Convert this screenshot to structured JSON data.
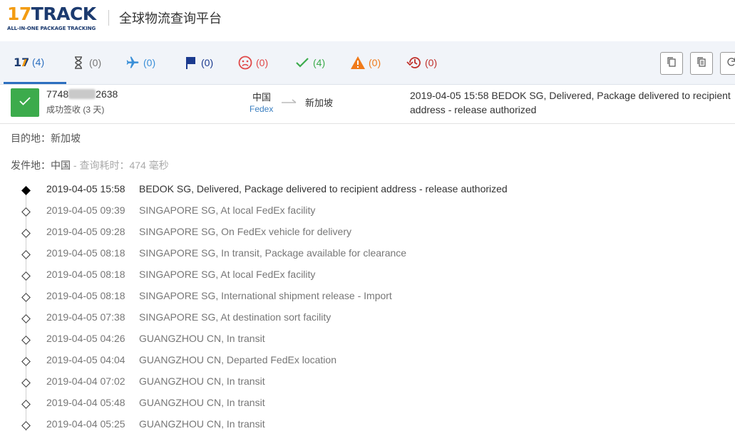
{
  "header": {
    "logo_text": "17TRACK",
    "logo_tagline": "ALL-IN-ONE PACKAGE TRACKING",
    "title": "全球物流查询平台"
  },
  "status_tabs": [
    {
      "name": "all",
      "icon": "17-logo-icon",
      "count": "(4)",
      "color": "#2c6fbf"
    },
    {
      "name": "not-found",
      "icon": "hourglass-icon",
      "count": "(0)",
      "color": "#666666"
    },
    {
      "name": "in-transit",
      "icon": "airplane-icon",
      "count": "(0)",
      "color": "#3a8fd8"
    },
    {
      "name": "pickup",
      "icon": "flag-icon",
      "count": "(0)",
      "color": "#1b3a8f"
    },
    {
      "name": "undelivered",
      "icon": "sad-face-icon",
      "count": "(0)",
      "color": "#e04848"
    },
    {
      "name": "delivered",
      "icon": "checkmark-icon",
      "count": "(4)",
      "color": "#3cab4c"
    },
    {
      "name": "alert",
      "icon": "warning-icon",
      "count": "(0)",
      "color": "#f07a1a"
    },
    {
      "name": "expired",
      "icon": "history-icon",
      "count": "(0)",
      "color": "#c0302b"
    }
  ],
  "package": {
    "tracking_prefix": "7748",
    "tracking_suffix": "2638",
    "status": "成功签收 (3 天)",
    "origin": "中国",
    "carrier": "Fedex",
    "destination": "新加坡",
    "latest_event": "2019-04-05 15:58  BEDOK SG, Delivered, Package delivered to recipient address - release authorized"
  },
  "info": {
    "destination_label": "目的地",
    "destination_value": "：新加坡",
    "origin_label": "发件地",
    "origin_value": "：中国",
    "query_time": " - 查询耗时：474 毫秒"
  },
  "events": [
    {
      "time": "2019-04-05 15:58",
      "desc": "BEDOK SG, Delivered, Package delivered to recipient address - release authorized"
    },
    {
      "time": "2019-04-05 09:39",
      "desc": "SINGAPORE SG, At local FedEx facility"
    },
    {
      "time": "2019-04-05 09:28",
      "desc": "SINGAPORE SG, On FedEx vehicle for delivery"
    },
    {
      "time": "2019-04-05 08:18",
      "desc": "SINGAPORE SG, In transit, Package available for clearance"
    },
    {
      "time": "2019-04-05 08:18",
      "desc": "SINGAPORE SG, At local FedEx facility"
    },
    {
      "time": "2019-04-05 08:18",
      "desc": "SINGAPORE SG, International shipment release - Import"
    },
    {
      "time": "2019-04-05 07:38",
      "desc": "SINGAPORE SG, At destination sort facility"
    },
    {
      "time": "2019-04-05 04:26",
      "desc": "GUANGZHOU CN, In transit"
    },
    {
      "time": "2019-04-05 04:04",
      "desc": "GUANGZHOU CN, Departed FedEx location"
    },
    {
      "time": "2019-04-04 07:02",
      "desc": "GUANGZHOU CN, In transit"
    },
    {
      "time": "2019-04-04 05:48",
      "desc": "GUANGZHOU CN, In transit"
    },
    {
      "time": "2019-04-04 05:25",
      "desc": "GUANGZHOU CN, In transit"
    }
  ]
}
